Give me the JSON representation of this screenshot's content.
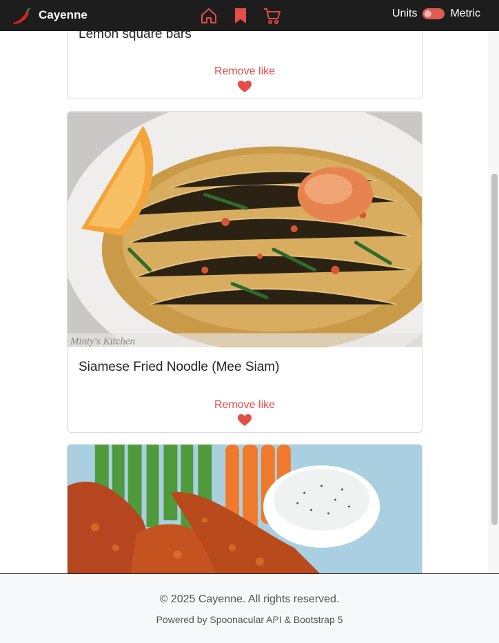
{
  "navbar": {
    "brand_name": "Cayenne",
    "units_label": "Units",
    "units_value": "Metric",
    "icons": [
      "home-icon",
      "bookmark-icon",
      "cart-icon"
    ],
    "accent_color": "#e44c47"
  },
  "cards": [
    {
      "title": "Lemon square bars",
      "action_label": "Remove like"
    },
    {
      "title": "Siamese Fried Noodle (Mee Siam)",
      "action_label": "Remove like",
      "image_watermark": "Minty's Kitchen"
    },
    {
      "title": "",
      "action_label": ""
    }
  ],
  "footer": {
    "copyright": "© 2025 Cayenne. All rights reserved.",
    "powered_by": "Powered by Spoonacular API & Bootstrap 5"
  }
}
